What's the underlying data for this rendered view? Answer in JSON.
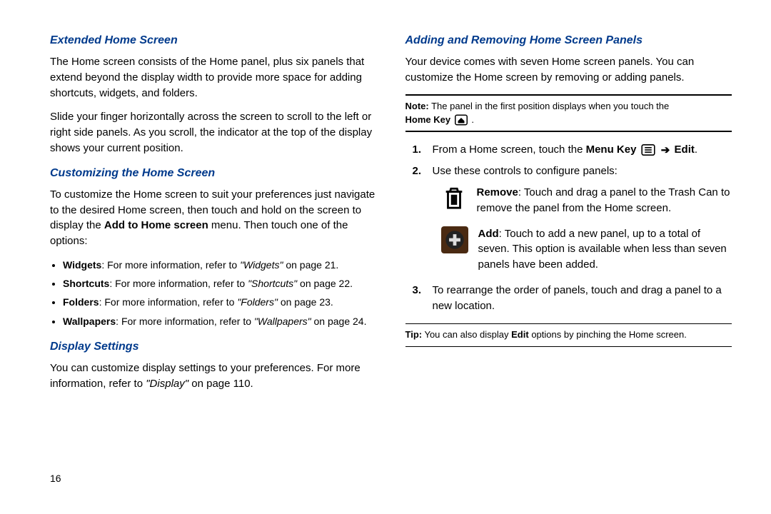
{
  "page_number": "16",
  "left": {
    "s1": {
      "title": "Extended Home Screen",
      "p1": "The Home screen consists of the Home panel, plus six panels that extend beyond the display width to provide more space for adding shortcuts, widgets, and folders.",
      "p2": "Slide your finger horizontally across the screen to scroll to the left or right side panels. As you scroll, the indicator at the top of the display shows your current position."
    },
    "s2": {
      "title": "Customizing the Home Screen",
      "p1a": "To customize the Home screen to suit your preferences just navigate to the desired Home screen, then touch and hold on the screen to display the ",
      "p1b": "Add to Home screen",
      "p1c": " menu. Then touch one of the options:",
      "bullets": [
        {
          "label": "Widgets",
          "rest": ": For more information, refer to ",
          "ref": "\"Widgets\"",
          "tail": "  on page 21."
        },
        {
          "label": "Shortcuts",
          "rest": ": For more information, refer to ",
          "ref": "\"Shortcuts\"",
          "tail": "  on page 22."
        },
        {
          "label": "Folders",
          "rest": ": For more information, refer to ",
          "ref": "\"Folders\"",
          "tail": "  on page 23."
        },
        {
          "label": "Wallpapers",
          "rest": ": For more information, refer to ",
          "ref": "\"Wallpapers\"",
          "tail": "  on page 24."
        }
      ]
    },
    "s3": {
      "title": "Display Settings",
      "p1a": "You can customize display settings to your preferences. For more information, refer to ",
      "p1b": "\"Display\"",
      "p1c": "  on page 110."
    }
  },
  "right": {
    "s1": {
      "title": "Adding and Removing Home Screen Panels",
      "p1": "Your device comes with seven Home screen panels. You can customize the Home screen by removing or adding panels."
    },
    "note": {
      "label": "Note:",
      "text_a": " The panel in the first position displays when you touch the ",
      "home_key": "Home Key",
      "tail": " ."
    },
    "steps": {
      "s1": {
        "num": "1.",
        "a": "From a Home screen, touch the ",
        "menu_key": "Menu Key",
        "arrow": "➔",
        "edit": "Edit",
        "tail": "."
      },
      "s2": {
        "num": "2.",
        "text": "Use these controls to configure panels:"
      },
      "controls": {
        "remove": {
          "label": "Remove",
          "text": ": Touch and drag a panel to the Trash Can to remove the panel from the Home screen."
        },
        "add": {
          "label": "Add",
          "text": ": Touch to add a new panel, up to a total of seven. This option is available when less than seven panels have been added."
        }
      },
      "s3": {
        "num": "3.",
        "text": "To rearrange the order of panels, touch and drag a panel to a new location."
      }
    },
    "tip": {
      "label": "Tip:",
      "a": " You can also display ",
      "edit": "Edit",
      "b": " options by pinching the Home screen."
    }
  }
}
